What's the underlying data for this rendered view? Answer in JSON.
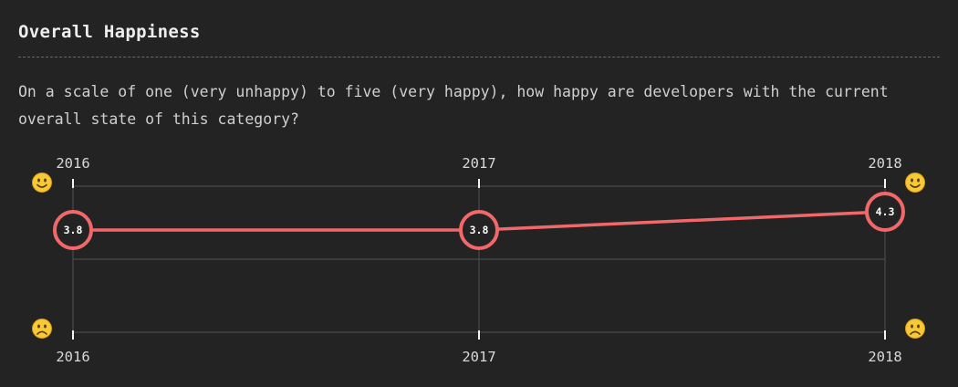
{
  "header": {
    "title": "Overall Happiness",
    "description": "On a scale of one (very unhappy) to five (very happy), how happy are developers with the current overall state of this category?"
  },
  "chart_data": {
    "type": "line",
    "x": [
      "2016",
      "2017",
      "2018"
    ],
    "series": [
      {
        "values": [
          3.8,
          3.8,
          4.3
        ]
      }
    ],
    "ylim": [
      1,
      5
    ],
    "grid": true,
    "top_labels": [
      "2016",
      "2017",
      "2018"
    ],
    "bottom_labels": [
      "2016",
      "2017",
      "2018"
    ],
    "point_labels": [
      "3.8",
      "3.8",
      "4.3"
    ],
    "icons": {
      "high": "slightly-smiling-face-icon",
      "low": "frowning-face-icon"
    }
  },
  "colors": {
    "background": "#222322",
    "series": "#f0686a",
    "grid": "#4a4a4a",
    "text": "#e8e8e8"
  }
}
